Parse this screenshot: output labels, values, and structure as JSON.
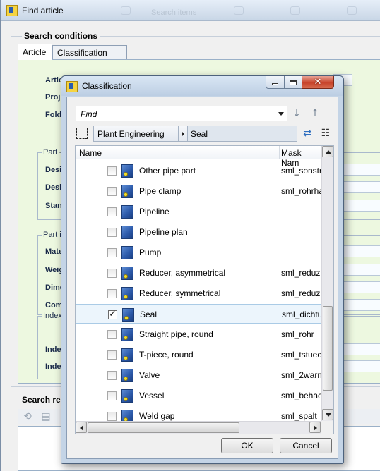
{
  "background_window": {
    "title": "Find article",
    "ghost_label": "Search items",
    "search_conditions_label": "Search conditions",
    "tabs": [
      "Article",
      "Classification"
    ],
    "field_labels": [
      "Artic",
      "Proj",
      "Fold"
    ],
    "groups": [
      {
        "label": "Part –",
        "fields": [
          "Desi",
          "Desi",
          "Stan"
        ]
      },
      {
        "label": "Part in",
        "fields": [
          "Mate",
          "Weig",
          "Dime",
          "Com"
        ]
      },
      {
        "label": "Index",
        "fields": [
          "Inde",
          "Inde"
        ]
      }
    ],
    "search_results_label": "Search res"
  },
  "dialog": {
    "title": "Classification",
    "find_placeholder": "Find",
    "breadcrumb": [
      "Plant Engineering",
      "Seal"
    ],
    "columns": {
      "name": "Name",
      "mask": "Mask Nam"
    },
    "rows": [
      {
        "name": "Other pipe part",
        "mask": "sml_sonstr",
        "checked": false,
        "dot": true
      },
      {
        "name": "Pipe clamp",
        "mask": "sml_rohrha",
        "checked": false,
        "dot": true
      },
      {
        "name": "Pipeline",
        "mask": "",
        "checked": false,
        "dot": false
      },
      {
        "name": "Pipeline plan",
        "mask": "",
        "checked": false,
        "dot": false
      },
      {
        "name": "Pump",
        "mask": "",
        "checked": false,
        "dot": false
      },
      {
        "name": "Reducer, asymmetrical",
        "mask": "sml_reduz",
        "checked": false,
        "dot": true
      },
      {
        "name": "Reducer, symmetrical",
        "mask": "sml_reduz",
        "checked": false,
        "dot": true
      },
      {
        "name": "Seal",
        "mask": "sml_dichtu",
        "checked": true,
        "dot": true,
        "selected": true
      },
      {
        "name": "Straight pipe, round",
        "mask": "sml_rohr",
        "checked": false,
        "dot": true
      },
      {
        "name": "T-piece, round",
        "mask": "sml_tstuec",
        "checked": false,
        "dot": true
      },
      {
        "name": "Valve",
        "mask": "sml_2warm",
        "checked": false,
        "dot": true
      },
      {
        "name": "Vessel",
        "mask": "sml_behae",
        "checked": false,
        "dot": true
      },
      {
        "name": "Weld gap",
        "mask": "sml_spalt",
        "checked": false,
        "dot": true
      }
    ],
    "ok_label": "OK",
    "cancel_label": "Cancel"
  },
  "colors": {
    "panel_green": "#edf8e0",
    "selection": "#ecf5fc",
    "close_red": "#c7432a",
    "class_icon_blue": "#2d5bab"
  }
}
